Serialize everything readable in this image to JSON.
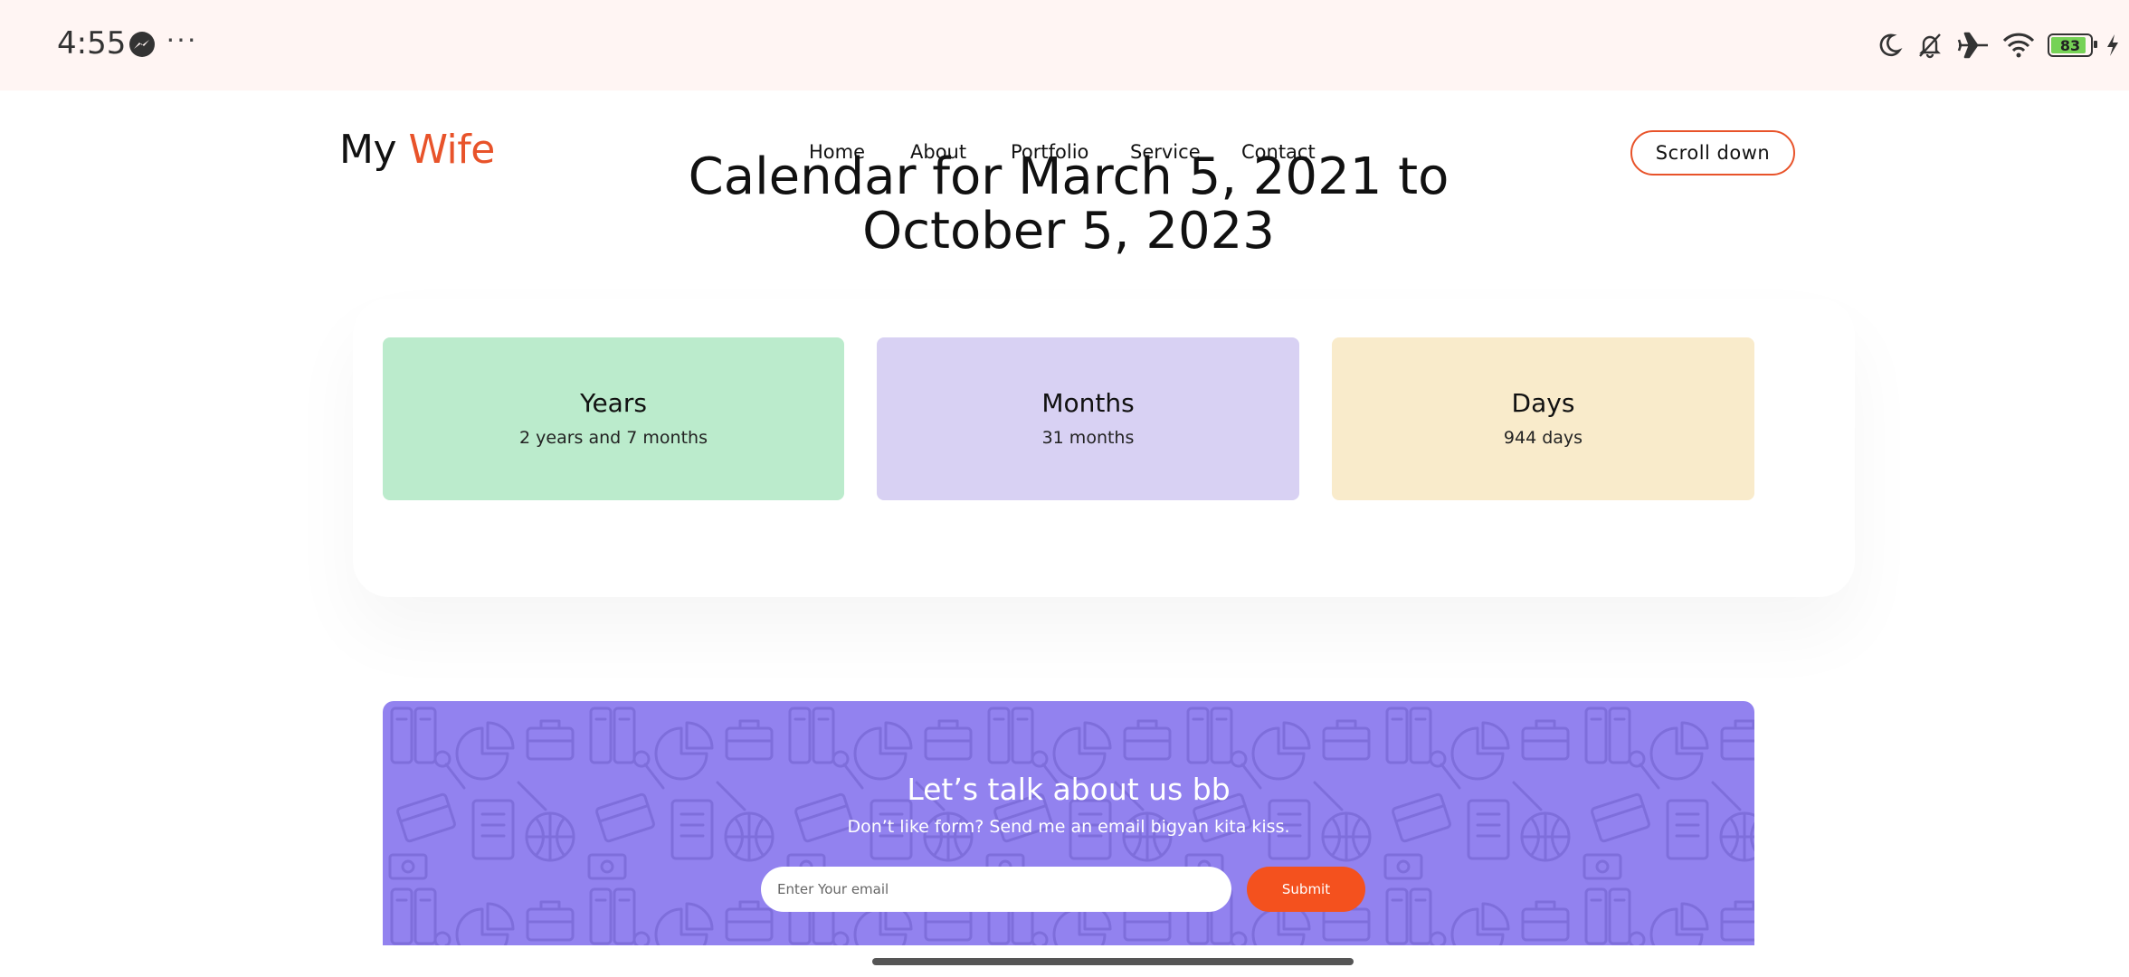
{
  "status_bar": {
    "time": "4:55",
    "more": "···",
    "battery_level": "83",
    "icons": [
      "messenger-icon",
      "moon-icon",
      "bell-off-icon",
      "airplane-icon",
      "wifi-icon",
      "battery-icon",
      "charging-icon"
    ]
  },
  "header": {
    "logo_main": "My",
    "logo_accent": "Wife",
    "nav": [
      "Home",
      "About",
      "Portfolio",
      "Service",
      "Contact"
    ],
    "cta": "Scroll down"
  },
  "main": {
    "title": "Calendar for March 5, 2021 to October 5, 2023",
    "cards": [
      {
        "title": "Years",
        "value": "2 years and 7 months",
        "color": "#bbebcc"
      },
      {
        "title": "Months",
        "value": "31 months",
        "color": "#d8d1f3"
      },
      {
        "title": "Days",
        "value": "944 days",
        "color": "#f9ebcb"
      }
    ]
  },
  "newsletter": {
    "heading": "Let’s talk about us bb",
    "subtext": "Don’t like form? Send me an email bigyan kita kiss.",
    "email_placeholder": "Enter Your email",
    "submit_label": "Submit",
    "background": "#9282ef",
    "button_color": "#f4511e"
  },
  "colors": {
    "accent": "#e8532a",
    "status_bg": "#fff5f3"
  }
}
